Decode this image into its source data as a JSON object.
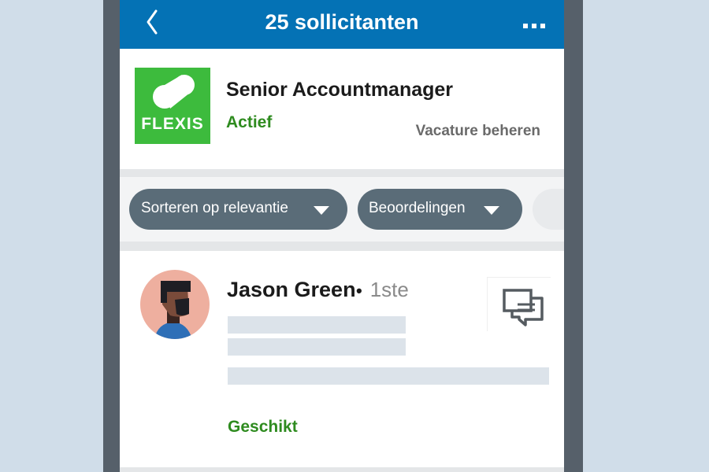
{
  "header": {
    "title": "25 sollicitanten",
    "back_icon": "chevron-left-icon",
    "more_icon": "more-horizontal-icon"
  },
  "job": {
    "company_logo_text": "FLEXIS",
    "title": "Senior Accountmanager",
    "status": "Actief",
    "manage_label": "Vacature beheren"
  },
  "filters": {
    "sort_label": "Sorteren op relevantie",
    "reviews_label": "Beoordelingen"
  },
  "applicant": {
    "name": "Jason Green",
    "separator": "•",
    "degree": "1ste",
    "rating_label": "Geschikt",
    "message_icon": "message-icon"
  },
  "colors": {
    "brand_blue": "#0472b5",
    "status_green": "#2e8b1f",
    "logo_green": "#3dbb3d",
    "pill_bg": "#5a6c78",
    "page_bg": "#d0dde9",
    "frame": "#56606a"
  }
}
